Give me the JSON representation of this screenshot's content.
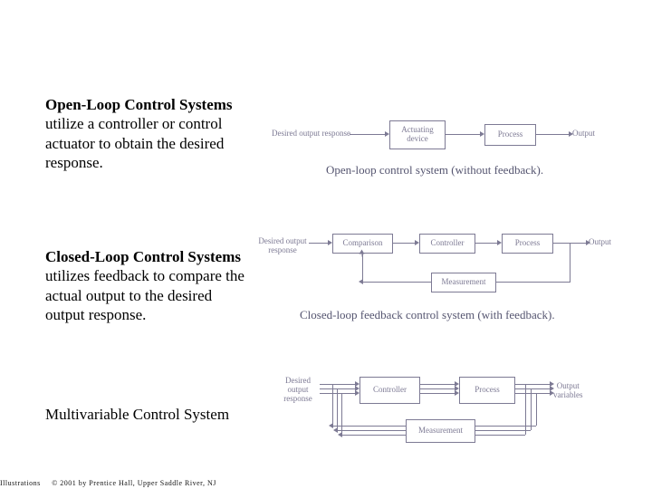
{
  "sections": {
    "open": {
      "bold": "Open-Loop Control Systems",
      "rest": " utilize a controller or control actuator to obtain the desired response."
    },
    "closed": {
      "bold": "Closed-Loop Control Systems",
      "rest": " utilizes feedback to compare the actual output to the desired output response."
    },
    "multi": {
      "title": "Multivariable Control System"
    }
  },
  "diagrams": {
    "open": {
      "input": "Desired output response",
      "b1": "Actuating\ndevice",
      "b2": "Process",
      "output": "Output",
      "caption": "Open-loop control system (without feedback)."
    },
    "closed": {
      "input": "Desired output\nresponse",
      "b1": "Comparison",
      "b2": "Controller",
      "b3": "Process",
      "output": "Output",
      "fb": "Measurement",
      "caption": "Closed-loop feedback control system (with feedback)."
    },
    "multi": {
      "input": "Desired\noutput\nresponse",
      "b1": "Controller",
      "b2": "Process",
      "output": "Output\nvariables",
      "fb": "Measurement"
    }
  },
  "footer": {
    "left": "Illustrations",
    "right": "© 2001  by Prentice Hall, Upper Saddle River, NJ"
  }
}
